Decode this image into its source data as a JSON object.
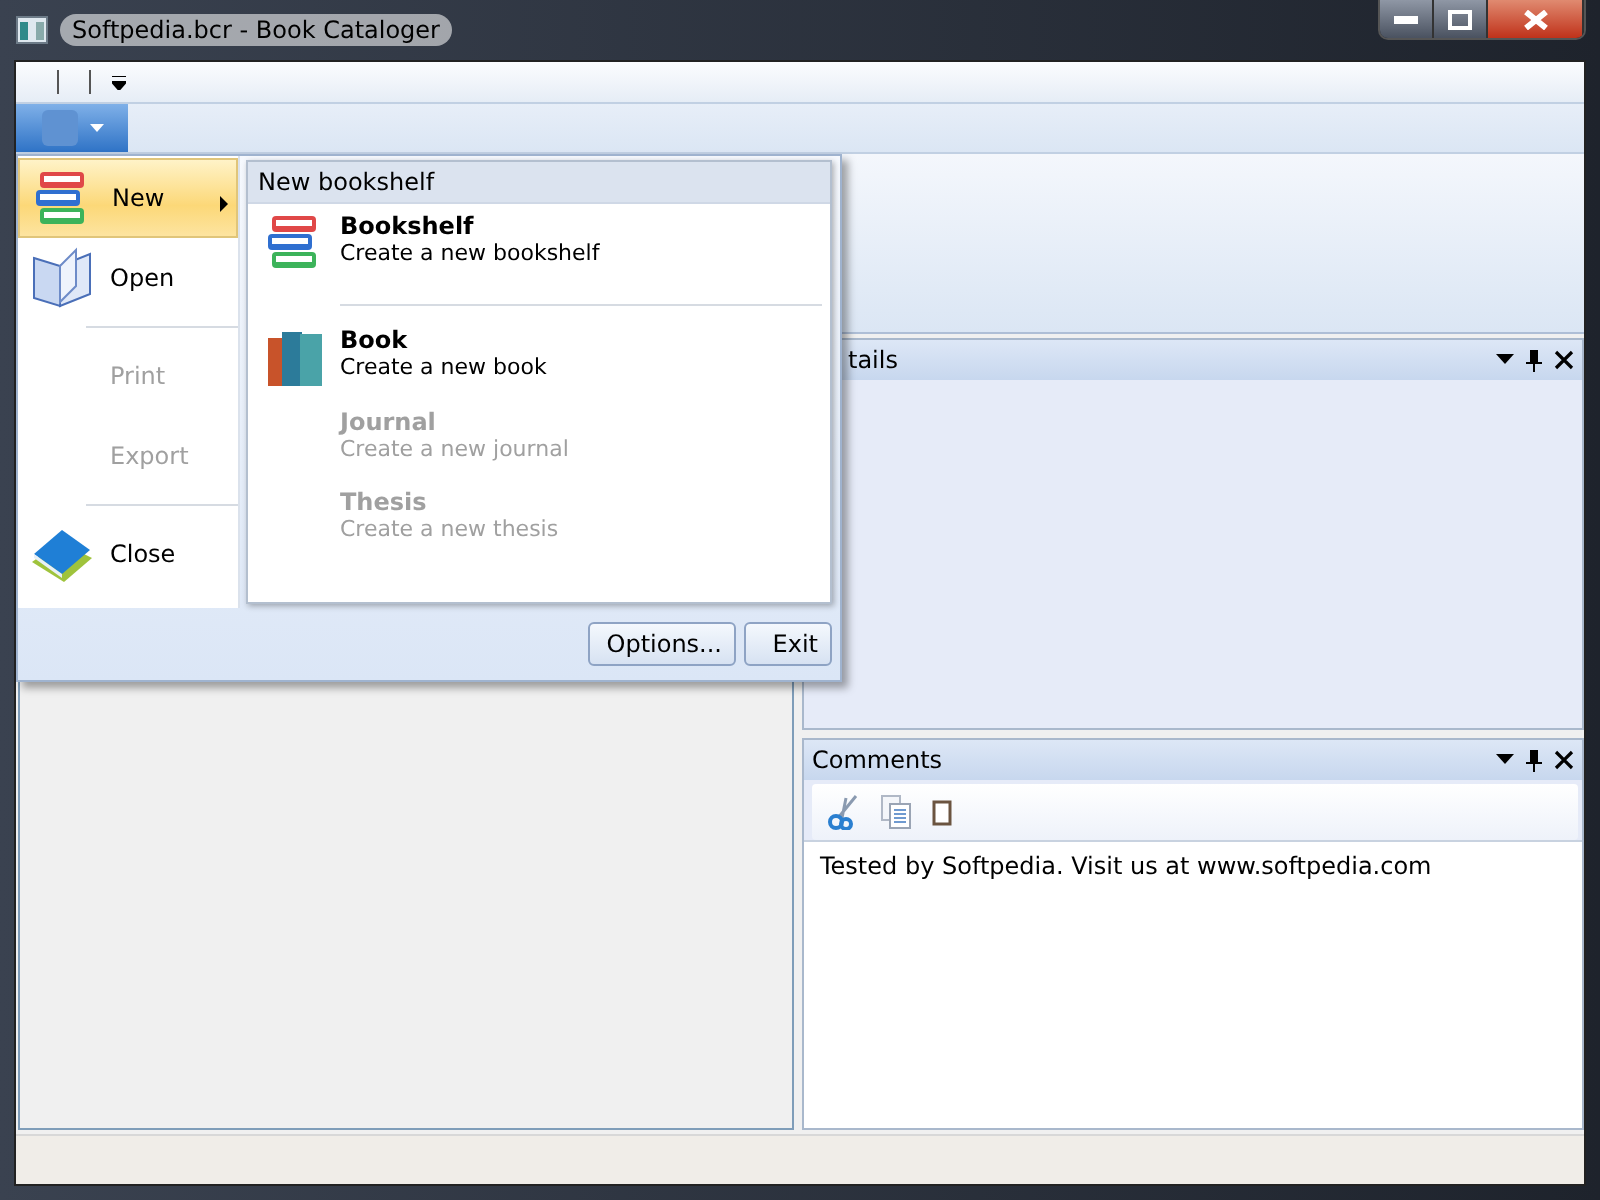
{
  "window": {
    "title": "Softpedia.bcr - Book Cataloger"
  },
  "app_menu": {
    "items": [
      {
        "label": "New",
        "selected": true,
        "disabled": false,
        "has_submenu": true,
        "separator_after": false
      },
      {
        "label": "Open",
        "selected": false,
        "disabled": false,
        "has_submenu": false,
        "separator_after": true
      },
      {
        "label": "Print",
        "selected": false,
        "disabled": true,
        "has_submenu": false,
        "separator_after": false
      },
      {
        "label": "Export",
        "selected": false,
        "disabled": true,
        "has_submenu": false,
        "separator_after": true
      },
      {
        "label": "Close",
        "selected": false,
        "disabled": false,
        "has_submenu": false,
        "separator_after": false
      }
    ],
    "submenu": {
      "header": "New bookshelf",
      "items": [
        {
          "title": "Bookshelf",
          "description": "Create a new bookshelf",
          "disabled": false,
          "separator_after": true
        },
        {
          "title": "Book",
          "description": "Create a new book",
          "disabled": false,
          "separator_after": false
        },
        {
          "title": "Journal",
          "description": "Create a new journal",
          "disabled": true,
          "separator_after": false
        },
        {
          "title": "Thesis",
          "description": "Create a new thesis",
          "disabled": true,
          "separator_after": false
        }
      ]
    },
    "buttons": [
      "Options...",
      "Exit"
    ]
  },
  "panes": [
    {
      "kind": "details",
      "title": "tails"
    },
    {
      "kind": "comments",
      "title": "Comments",
      "text": "Tested by Softpedia. Visit us at www.softpedia.com"
    }
  ]
}
